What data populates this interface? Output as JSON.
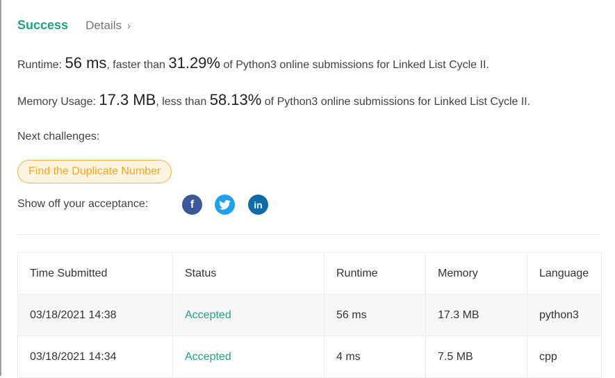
{
  "header": {
    "status": "Success",
    "details_label": "Details",
    "details_chevron": "›"
  },
  "runtime": {
    "label": "Runtime:",
    "value": "56 ms",
    "mid": ", faster than",
    "percent": "31.29%",
    "suffix": "of Python3 online submissions for Linked List Cycle II."
  },
  "memory": {
    "label": "Memory Usage:",
    "value": "17.3 MB",
    "mid": ", less than",
    "percent": "58.13%",
    "suffix": "of Python3 online submissions for Linked List Cycle II."
  },
  "next_label": "Next challenges:",
  "next_challenge": "Find the Duplicate Number",
  "share_label": "Show off your acceptance:",
  "social": {
    "facebook": "f",
    "twitter": "t",
    "linkedin": "in"
  },
  "table": {
    "headers": [
      "Time Submitted",
      "Status",
      "Runtime",
      "Memory",
      "Language"
    ],
    "rows": [
      [
        "03/18/2021 14:38",
        "Accepted",
        "56 ms",
        "17.3 MB",
        "python3"
      ],
      [
        "03/18/2021 14:34",
        "Accepted",
        "4 ms",
        "7.5 MB",
        "cpp"
      ]
    ]
  }
}
